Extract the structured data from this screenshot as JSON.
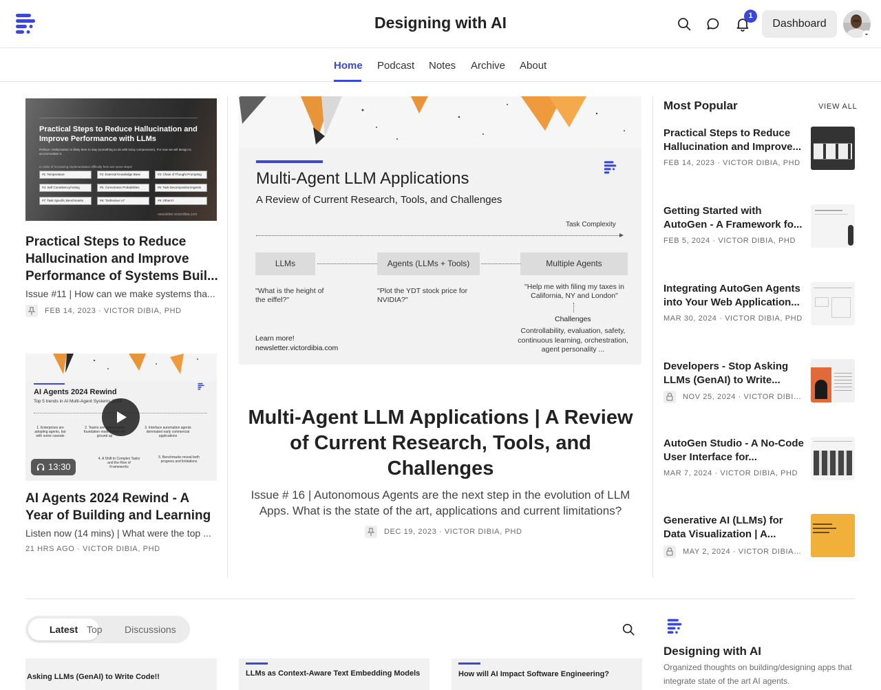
{
  "header": {
    "title": "Designing with AI",
    "notification_count": "1",
    "dashboard_label": "Dashboard",
    "icons": [
      "search-icon",
      "chat-icon",
      "bell-icon"
    ]
  },
  "nav": {
    "items": [
      {
        "label": "Home",
        "active": true
      },
      {
        "label": "Podcast"
      },
      {
        "label": "Notes"
      },
      {
        "label": "Archive"
      },
      {
        "label": "About"
      }
    ]
  },
  "left_posts": [
    {
      "title": "Practical Steps to Reduce Hallucination and Improve Performance of Systems Buil...",
      "subtitle": "Issue #11 | How can we make systems tha...",
      "meta": "FEB 14, 2023 · VICTOR DIBIA, PHD",
      "thumb": {
        "title": "Practical Steps to Reduce Hallucination and Improve Performance with LLMs",
        "preface": "Preface: Hallucination is likely here to stay (something to do with lossy compression). For now we will design to accommodate it.",
        "hint": "In order of increasing implementation difficulty here are some steps!",
        "steps": [
          "#1: Temperature",
          "#2: External Knowledge Base",
          "#3: Chain of Thought Prompting",
          "#4: Self Consistency/Voting",
          "#5: Correctness Probabilities",
          "#6: Task Decomposition/Agents",
          "#7: Task Specific Benchmarks",
          "#8: \"Defensive UI\"",
          "#9: Others?"
        ],
        "url": "newsletter.victordibia.com"
      }
    },
    {
      "title": "AI Agents 2024 Rewind - A Year of Building and Learning",
      "subtitle": "Listen now (14 mins) | What were the top ...",
      "meta": "21 HRS AGO · VICTOR DIBIA, PHD",
      "duration": "13:30",
      "thumb": {
        "title": "AI Agents 2024 Rewind",
        "sub": "Top 5 trends in AI Multi-Agent Systems 2024",
        "items": [
          "1. Enterprises are adopting agents, but with some caveats",
          "2. Teams are agent-native foundation models from the ground up",
          "3. Interface automation agents dominated early commercial applications",
          "4. A Shift to Complex Tasks and the Rise of Frameworks",
          "5. Benchmarks reveal both progress and limitations"
        ]
      }
    }
  ],
  "featured": {
    "slide": {
      "title": "Multi-Agent LLM Applications",
      "subtitle": "A Review of Current Research, Tools, and Challenges",
      "axis_label": "Task Complexity",
      "boxes": [
        "LLMs",
        "Agents (LLMs + Tools)",
        "Multiple Agents"
      ],
      "examples": [
        "\"What is the height of the eiffel?\"",
        "\"Plot the YDT stock price for NVIDIA?\"",
        "\"Help me with filing my taxes in California, NY and London\""
      ],
      "challenges_label": "Challenges",
      "challenges": "Controllability, evaluation, safety, continuous learning, orchestration, agent personality ...",
      "learn_more": "Learn more!",
      "learn_more_url": "newsletter.victordibia.com"
    },
    "title": "Multi-Agent LLM Applications | A Review of Current Research, Tools, and Challenges",
    "subtitle": "Issue # 16 | Autonomous Agents are the next step in the evolution of LLM Apps. What is the state of the art, applications and current limitations?",
    "meta": "DEC 19, 2023 · VICTOR DIBIA, PHD"
  },
  "popular": {
    "heading": "Most Popular",
    "view_all": "VIEW ALL",
    "items": [
      {
        "title": "Practical Steps to Reduce Hallucination and Improve...",
        "meta": "FEB 14, 2023 · VICTOR DIBIA, PHD"
      },
      {
        "title": "Getting Started with AutoGen - A Framework fo...",
        "meta": "FEB 5, 2024 · VICTOR DIBIA, PHD"
      },
      {
        "title": "Integrating AutoGen Agents into Your Web Application...",
        "meta": "MAR 30, 2024 · VICTOR DIBIA, PHD"
      },
      {
        "title": "Developers - Stop Asking LLMs (GenAI) to Write...",
        "meta": "NOV 25, 2024 · VICTOR DIBIA..."
      },
      {
        "title": "AutoGen Studio - A No-Code User Interface for...",
        "meta": "MAR 7, 2024 · VICTOR DIBIA, PHD"
      },
      {
        "title": "Generative AI (LLMs) for Data Visualization | A...",
        "meta": "MAY 2, 2024 · VICTOR DIBIA,..."
      }
    ]
  },
  "feed": {
    "tabs": [
      "Latest",
      "Top",
      "Discussions"
    ],
    "cards": [
      "Asking LLMs (GenAI) to Write Code!!",
      "LLMs as Context-Aware Text Embedding Models",
      "How will AI Impact Software Engineering?"
    ]
  },
  "about": {
    "title": "Designing with AI",
    "description": "Organized thoughts on building/designing apps that integrate state of the art AI agents."
  },
  "colors": {
    "accent": "#3b47d6",
    "text": "#222222",
    "muted": "#6b6b6b"
  }
}
